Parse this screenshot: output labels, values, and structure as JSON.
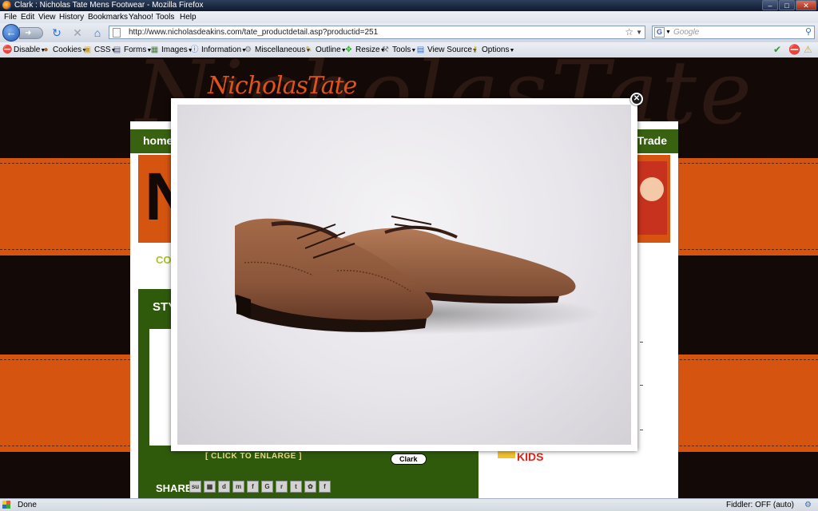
{
  "window": {
    "title": "Clark : Nicholas Tate Mens Footwear - Mozilla Firefox"
  },
  "menu": [
    "File",
    "Edit",
    "View",
    "History",
    "Bookmarks",
    "Yahoo!",
    "Tools",
    "Help"
  ],
  "address": {
    "url": "http://www.nicholasdeakins.com/tate_productdetail.asp?productid=251"
  },
  "search": {
    "placeholder": "Google",
    "engine_letter": "G"
  },
  "devbar": {
    "items": [
      "Disable",
      "Cookies",
      "CSS",
      "Forms",
      "Images",
      "Information",
      "Miscellaneous",
      "Outline",
      "Resize",
      "Tools",
      "View Source",
      "Options"
    ]
  },
  "site": {
    "logo": "NicholasTate",
    "nav_home": "home",
    "nav_trade": "Trade",
    "collection_label": "COL",
    "styles_label": "STY",
    "click_to_enlarge": "[ CLICK TO ENLARGE ]",
    "product_button": "Clark",
    "share_label": "SHARE :",
    "kids_label": "KIDS"
  },
  "lightbox": {
    "image_alt": "Brown leather lace-up brogue shoes"
  },
  "status": {
    "left": "Done",
    "fiddler": "Fiddler: OFF (auto)"
  },
  "colors": {
    "orange": "#d45410",
    "dark": "#130906",
    "green": "#386110"
  }
}
